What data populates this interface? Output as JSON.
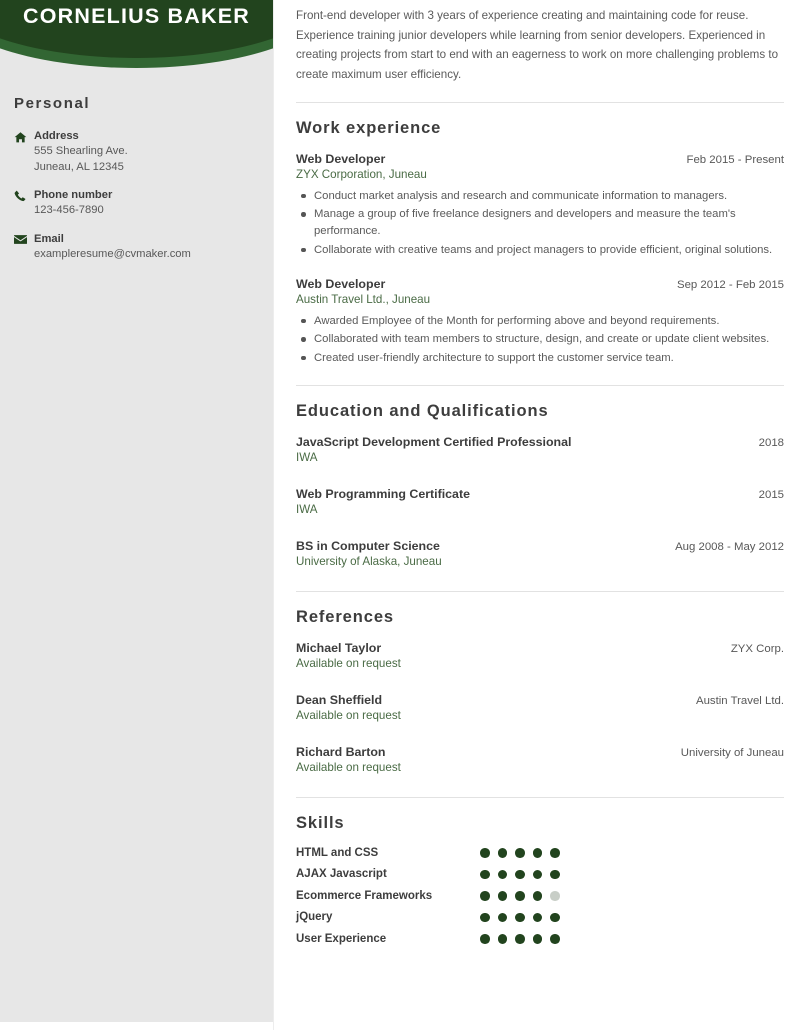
{
  "theme": {
    "green_dark": "#22441e",
    "green_mid": "#326633",
    "green_text": "#4a6b45",
    "sidebar_bg": "#e7e7e7",
    "dot_off": "#c8cec7"
  },
  "sidebar": {
    "full_name": "CORNELIUS BAKER",
    "personal_title": "Personal",
    "contacts": [
      {
        "icon": "home-icon",
        "label": "Address",
        "lines": [
          "555 Shearling Ave.",
          "Juneau, AL 12345"
        ]
      },
      {
        "icon": "phone-icon",
        "label": "Phone number",
        "lines": [
          "123-456-7890"
        ]
      },
      {
        "icon": "envelope-icon",
        "label": "Email",
        "lines": [
          "exampleresume@cvmaker.com"
        ]
      }
    ]
  },
  "main": {
    "summary": "Front-end developer with 3 years of experience creating and maintaining code for reuse. Experience training junior developers while learning from senior developers. Experienced in creating projects from start to end with an eagerness to work on more challenging problems to create maximum user efficiency.",
    "work": {
      "title": "Work experience",
      "entries": [
        {
          "role": "Web Developer",
          "date": "Feb 2015 - Present",
          "company": "ZYX Corporation, Juneau",
          "bullets": [
            "Conduct market analysis and research and communicate information to managers.",
            "Manage a group of five freelance designers and developers and measure the team's performance.",
            "Collaborate with creative teams and project managers to provide efficient, original solutions."
          ]
        },
        {
          "role": "Web Developer",
          "date": "Sep 2012 - Feb 2015",
          "company": "Austin Travel Ltd., Juneau",
          "bullets": [
            "Awarded Employee of the Month for performing above and beyond requirements.",
            "Collaborated with team members to structure, design, and create or update client websites.",
            "Created user-friendly architecture to support the customer service team."
          ]
        }
      ]
    },
    "education": {
      "title": "Education and Qualifications",
      "entries": [
        {
          "degree": "JavaScript Development Certified Professional",
          "date": "2018",
          "institution": "IWA"
        },
        {
          "degree": "Web Programming Certificate",
          "date": "2015",
          "institution": "IWA"
        },
        {
          "degree": "BS in Computer Science",
          "date": "Aug 2008 - May 2012",
          "institution": "University of Alaska, Juneau"
        }
      ]
    },
    "references": {
      "title": "References",
      "entries": [
        {
          "name": "Michael Taylor",
          "organization": "ZYX Corp.",
          "availability": "Available on request"
        },
        {
          "name": "Dean Sheffield",
          "organization": "Austin Travel Ltd.",
          "availability": "Available on request"
        },
        {
          "name": "Richard Barton",
          "organization": "University of Juneau",
          "availability": "Available on request"
        }
      ]
    },
    "skills": {
      "title": "Skills",
      "max_rating": 5,
      "entries": [
        {
          "name": "HTML and CSS",
          "rating": 5
        },
        {
          "name": "AJAX Javascript",
          "rating": 5
        },
        {
          "name": "Ecommerce Frameworks",
          "rating": 4
        },
        {
          "name": "jQuery",
          "rating": 5
        },
        {
          "name": "User Experience",
          "rating": 5
        }
      ]
    }
  }
}
